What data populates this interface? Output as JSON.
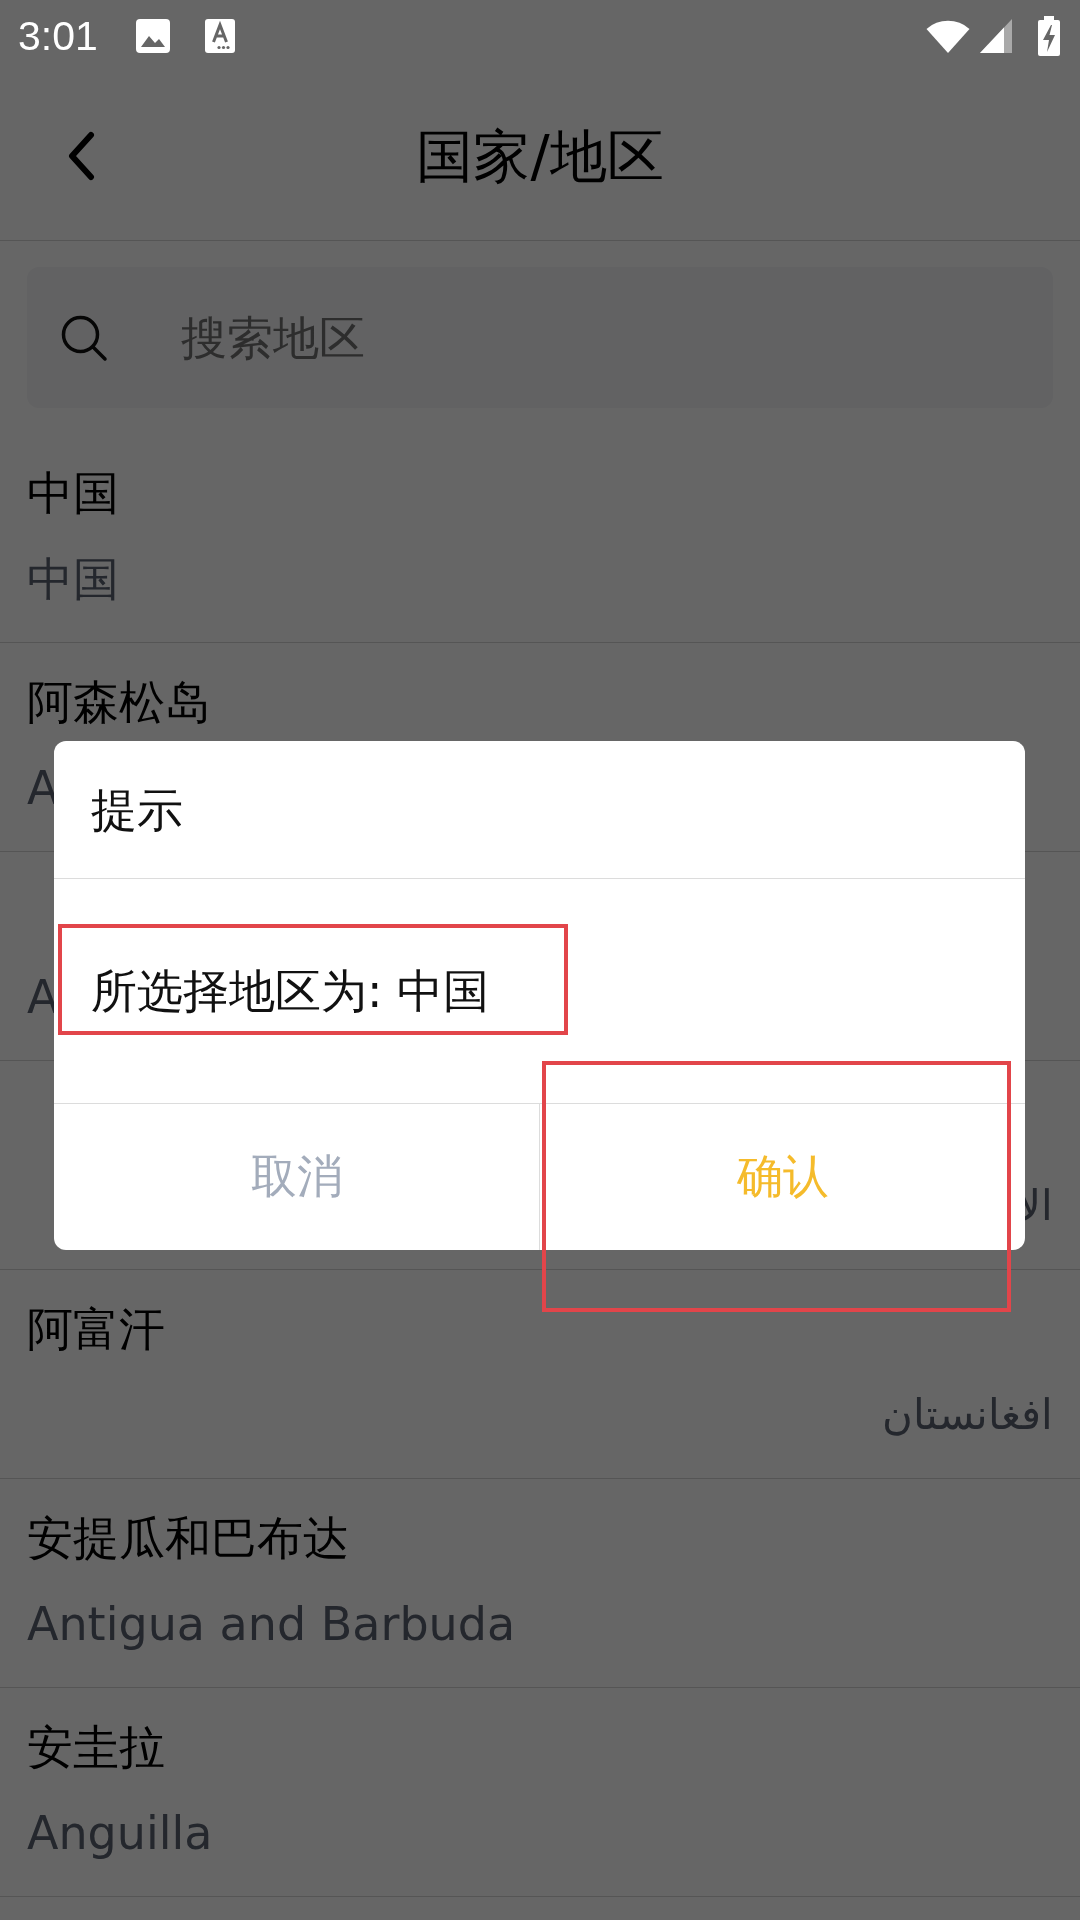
{
  "status_bar": {
    "time": "3:01"
  },
  "header": {
    "title": "国家/地区"
  },
  "search": {
    "placeholder": "搜索地区"
  },
  "countries": [
    {
      "name": "中国",
      "native_name": "中国"
    },
    {
      "name": "阿森松岛",
      "native_name": "A"
    },
    {
      "native_name": "A"
    },
    {
      "native_name": "الا"
    },
    {
      "name": "阿富汗",
      "native_name": "افغانستان"
    },
    {
      "name": "安提瓜和巴布达",
      "native_name": "Antigua and Barbuda"
    },
    {
      "name": "安圭拉",
      "native_name": "Anguilla"
    }
  ],
  "dialog": {
    "title": "提示",
    "message": {
      "text": "所选择地区为: 中国",
      "highlighted": true
    },
    "buttons": [
      {
        "kind": "cancel",
        "label": "取消",
        "highlighted": false
      },
      {
        "kind": "confirm",
        "label": "确认",
        "highlighted": true
      }
    ]
  }
}
